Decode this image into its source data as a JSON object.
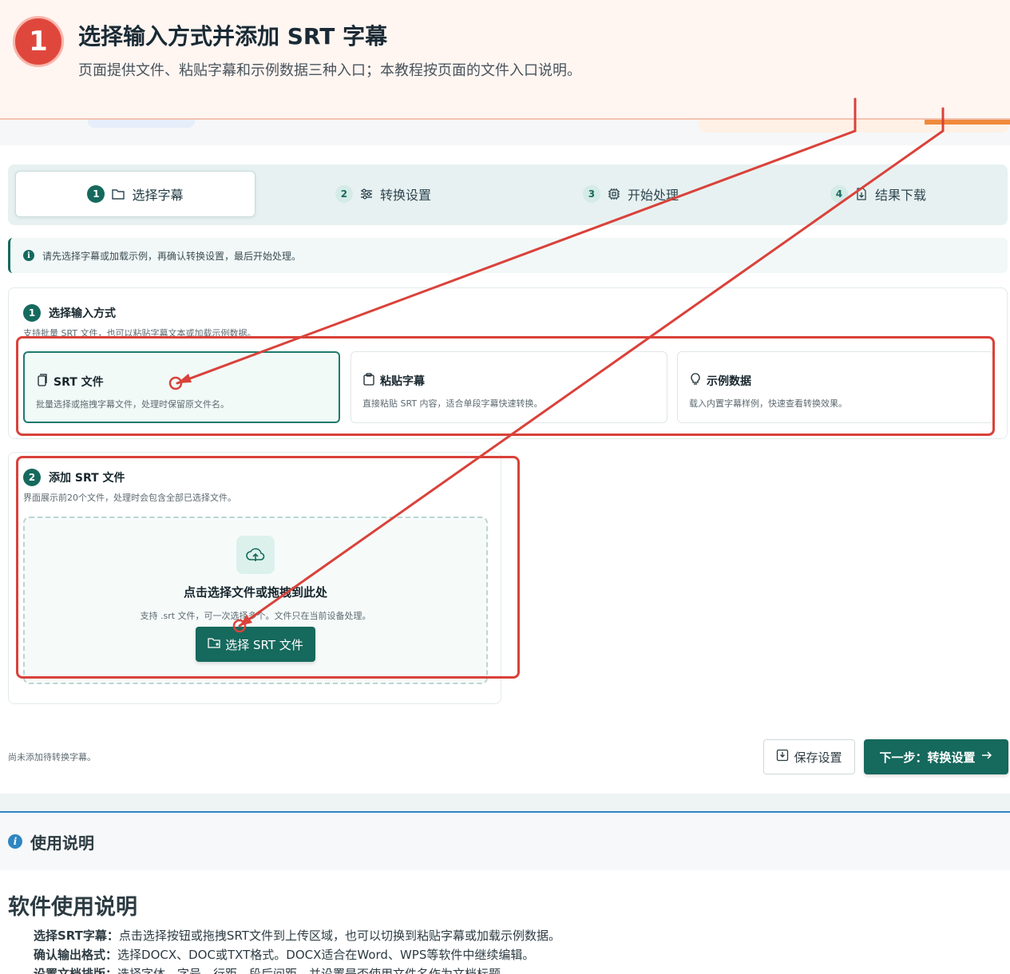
{
  "banner": {
    "step_number": "1",
    "title": "选择输入方式并添加 SRT 字幕",
    "description": "页面提供文件、粘贴字幕和示例数据三种入口；本教程按页面的文件入口说明。"
  },
  "stepper": {
    "steps": [
      {
        "num": "1",
        "label": "选择字幕",
        "icon": "folder-icon",
        "active": true
      },
      {
        "num": "2",
        "label": "转换设置",
        "icon": "sliders-icon",
        "active": false
      },
      {
        "num": "3",
        "label": "开始处理",
        "icon": "chip-icon",
        "active": false
      },
      {
        "num": "4",
        "label": "结果下载",
        "icon": "file-download-icon",
        "active": false
      }
    ]
  },
  "info": {
    "text": "请先选择字幕或加载示例，再确认转换设置，最后开始处理。",
    "icon_glyph": "i"
  },
  "input_section": {
    "num": "1",
    "title": "选择输入方式",
    "subtitle": "支持批量 SRT 文件，也可以粘贴字幕文本或加载示例数据。",
    "options": [
      {
        "title": "SRT 文件",
        "desc": "批量选择或拖拽字幕文件，处理时保留原文件名。",
        "icon": "files-icon",
        "selected": true
      },
      {
        "title": "粘贴字幕",
        "desc": "直接粘贴 SRT 内容，适合单段字幕快速转换。",
        "icon": "clipboard-icon",
        "selected": false
      },
      {
        "title": "示例数据",
        "desc": "载入内置字幕样例，快速查看转换效果。",
        "icon": "lightbulb-icon",
        "selected": false
      }
    ]
  },
  "add_section": {
    "num": "2",
    "title": "添加 SRT 文件",
    "subtitle": "界面展示前20个文件，处理时会包含全部已选择文件。",
    "drop_title": "点击选择文件或拖拽到此处",
    "drop_desc": "支持 .srt 文件，可一次选择多个。文件只在当前设备处理。",
    "button_label": "选择 SRT 文件"
  },
  "footer": {
    "status": "尚未添加待转换字幕。",
    "save_label": "保存设置",
    "next_label": "下一步：转换设置"
  },
  "usage": {
    "header": "使用说明",
    "header_icon": "i",
    "heading": "软件使用说明",
    "items": [
      {
        "key": "选择SRT字幕：",
        "text": "点击选择按钮或拖拽SRT文件到上传区域，也可以切换到粘贴字幕或加载示例数据。"
      },
      {
        "key": "确认输出格式：",
        "text": "选择DOCX、DOC或TXT格式。DOCX适合在Word、WPS等软件中继续编辑。"
      },
      {
        "key": "设置文档排版：",
        "text": "选择字体、字号、行距、段后间距，并设置是否使用文件名作为文档标题。"
      }
    ]
  },
  "colors": {
    "accent": "#16695d",
    "annotation": "#d9423a",
    "banner_bg": "#fff5f1"
  }
}
